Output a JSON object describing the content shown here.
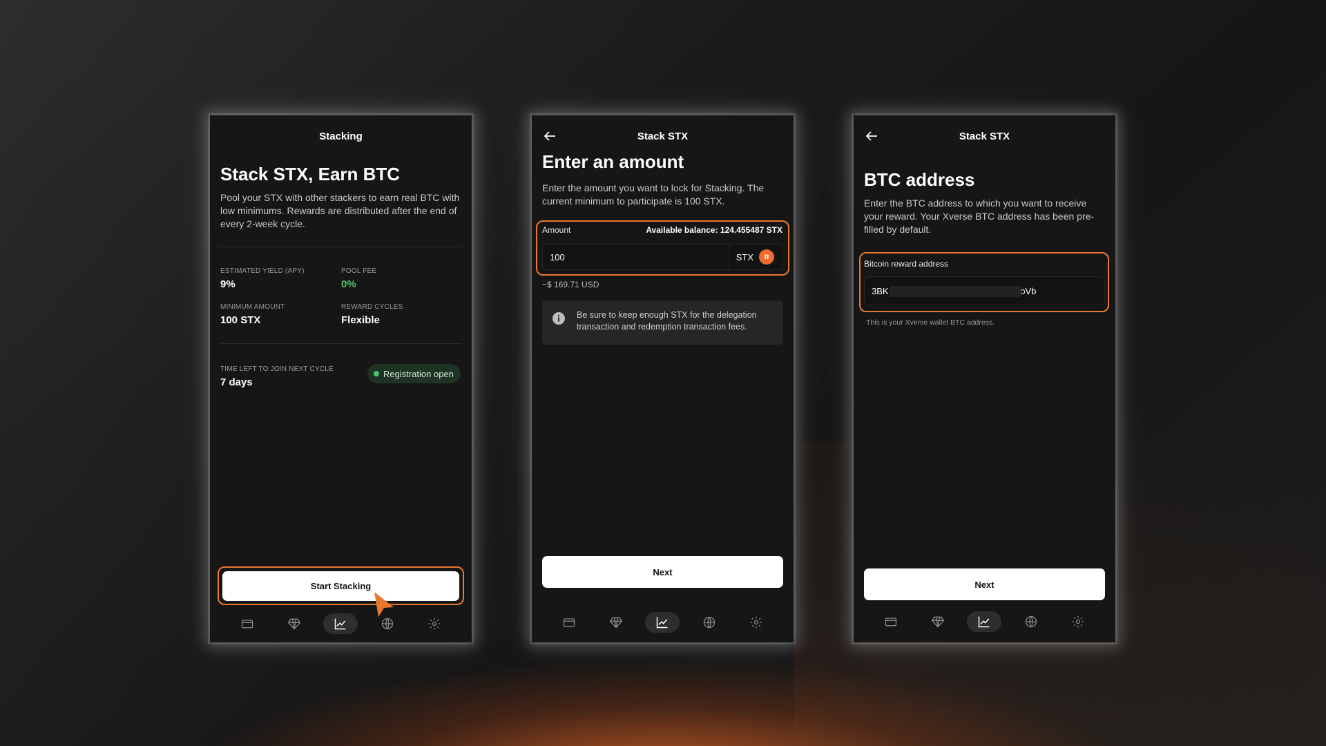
{
  "screen1": {
    "header_title": "Stacking",
    "heading": "Stack STX, Earn BTC",
    "description": "Pool your STX with other stackers to earn real BTC with low minimums. Rewards are distributed after the end of every 2-week cycle.",
    "stats": {
      "estimated_yield_label": "ESTIMATED YIELD (APY)",
      "estimated_yield_value": "9%",
      "pool_fee_label": "POOL FEE",
      "pool_fee_value": "0%",
      "minimum_amount_label": "MINIMUM AMOUNT",
      "minimum_amount_value": "100 STX",
      "reward_cycles_label": "REWARD CYCLES",
      "reward_cycles_value": "Flexible"
    },
    "time_left_label": "TIME LEFT TO JOIN NEXT CYCLE",
    "time_left_value": "7 days",
    "badge_label": "Registration open",
    "button_label": "Start Stacking"
  },
  "screen2": {
    "header_title": "Stack STX",
    "heading": "Enter an amount",
    "description": "Enter the amount you want to lock for Stacking. The current minimum to participate is 100 STX.",
    "amount_label": "Amount",
    "available_balance": "Available balance: 124.455487 STX",
    "amount_value": "100",
    "currency": "STX",
    "coin_glyph": "⌗",
    "usd_value": "~$ 169.71 USD",
    "info_text": "Be sure to keep enough STX for the delegation transaction and redemption transaction fees.",
    "button_label": "Next"
  },
  "screen3": {
    "header_title": "Stack STX",
    "heading": "BTC address",
    "description": "Enter the BTC address to which you want to receive your reward. Your Xverse BTC address has been pre-filled by default.",
    "field_label": "Bitcoin reward address",
    "address_prefix": "3BK",
    "address_suffix": "ɔVb",
    "hint": "This is your Xverse wallet BTC address.",
    "button_label": "Next"
  },
  "colors": {
    "accent": "#e8782e",
    "success": "#4fc36b",
    "coin": "#f26b2e",
    "panel": "#161616"
  },
  "nav_icons": [
    "wallet-icon",
    "gem-icon",
    "chart-icon",
    "globe-icon",
    "settings-icon"
  ],
  "active_nav": "chart-icon"
}
